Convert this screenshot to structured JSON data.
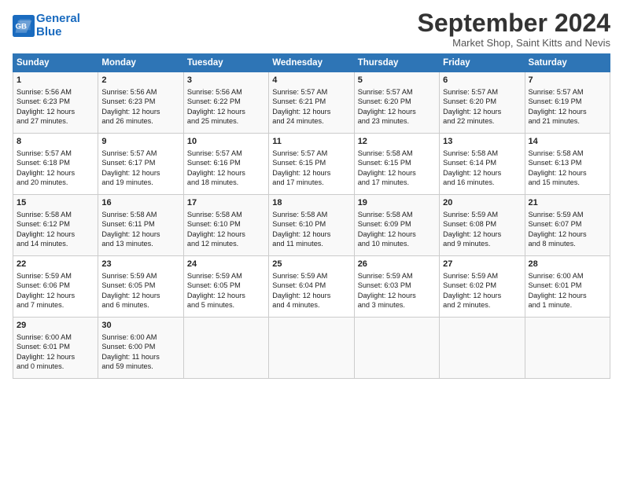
{
  "header": {
    "logo_line1": "General",
    "logo_line2": "Blue",
    "month_title": "September 2024",
    "subtitle": "Market Shop, Saint Kitts and Nevis"
  },
  "days_of_week": [
    "Sunday",
    "Monday",
    "Tuesday",
    "Wednesday",
    "Thursday",
    "Friday",
    "Saturday"
  ],
  "weeks": [
    [
      {
        "day": "1",
        "lines": [
          "Sunrise: 5:56 AM",
          "Sunset: 6:23 PM",
          "Daylight: 12 hours",
          "and 27 minutes."
        ]
      },
      {
        "day": "2",
        "lines": [
          "Sunrise: 5:56 AM",
          "Sunset: 6:23 PM",
          "Daylight: 12 hours",
          "and 26 minutes."
        ]
      },
      {
        "day": "3",
        "lines": [
          "Sunrise: 5:56 AM",
          "Sunset: 6:22 PM",
          "Daylight: 12 hours",
          "and 25 minutes."
        ]
      },
      {
        "day": "4",
        "lines": [
          "Sunrise: 5:57 AM",
          "Sunset: 6:21 PM",
          "Daylight: 12 hours",
          "and 24 minutes."
        ]
      },
      {
        "day": "5",
        "lines": [
          "Sunrise: 5:57 AM",
          "Sunset: 6:20 PM",
          "Daylight: 12 hours",
          "and 23 minutes."
        ]
      },
      {
        "day": "6",
        "lines": [
          "Sunrise: 5:57 AM",
          "Sunset: 6:20 PM",
          "Daylight: 12 hours",
          "and 22 minutes."
        ]
      },
      {
        "day": "7",
        "lines": [
          "Sunrise: 5:57 AM",
          "Sunset: 6:19 PM",
          "Daylight: 12 hours",
          "and 21 minutes."
        ]
      }
    ],
    [
      {
        "day": "8",
        "lines": [
          "Sunrise: 5:57 AM",
          "Sunset: 6:18 PM",
          "Daylight: 12 hours",
          "and 20 minutes."
        ]
      },
      {
        "day": "9",
        "lines": [
          "Sunrise: 5:57 AM",
          "Sunset: 6:17 PM",
          "Daylight: 12 hours",
          "and 19 minutes."
        ]
      },
      {
        "day": "10",
        "lines": [
          "Sunrise: 5:57 AM",
          "Sunset: 6:16 PM",
          "Daylight: 12 hours",
          "and 18 minutes."
        ]
      },
      {
        "day": "11",
        "lines": [
          "Sunrise: 5:57 AM",
          "Sunset: 6:15 PM",
          "Daylight: 12 hours",
          "and 17 minutes."
        ]
      },
      {
        "day": "12",
        "lines": [
          "Sunrise: 5:58 AM",
          "Sunset: 6:15 PM",
          "Daylight: 12 hours",
          "and 17 minutes."
        ]
      },
      {
        "day": "13",
        "lines": [
          "Sunrise: 5:58 AM",
          "Sunset: 6:14 PM",
          "Daylight: 12 hours",
          "and 16 minutes."
        ]
      },
      {
        "day": "14",
        "lines": [
          "Sunrise: 5:58 AM",
          "Sunset: 6:13 PM",
          "Daylight: 12 hours",
          "and 15 minutes."
        ]
      }
    ],
    [
      {
        "day": "15",
        "lines": [
          "Sunrise: 5:58 AM",
          "Sunset: 6:12 PM",
          "Daylight: 12 hours",
          "and 14 minutes."
        ]
      },
      {
        "day": "16",
        "lines": [
          "Sunrise: 5:58 AM",
          "Sunset: 6:11 PM",
          "Daylight: 12 hours",
          "and 13 minutes."
        ]
      },
      {
        "day": "17",
        "lines": [
          "Sunrise: 5:58 AM",
          "Sunset: 6:10 PM",
          "Daylight: 12 hours",
          "and 12 minutes."
        ]
      },
      {
        "day": "18",
        "lines": [
          "Sunrise: 5:58 AM",
          "Sunset: 6:10 PM",
          "Daylight: 12 hours",
          "and 11 minutes."
        ]
      },
      {
        "day": "19",
        "lines": [
          "Sunrise: 5:58 AM",
          "Sunset: 6:09 PM",
          "Daylight: 12 hours",
          "and 10 minutes."
        ]
      },
      {
        "day": "20",
        "lines": [
          "Sunrise: 5:59 AM",
          "Sunset: 6:08 PM",
          "Daylight: 12 hours",
          "and 9 minutes."
        ]
      },
      {
        "day": "21",
        "lines": [
          "Sunrise: 5:59 AM",
          "Sunset: 6:07 PM",
          "Daylight: 12 hours",
          "and 8 minutes."
        ]
      }
    ],
    [
      {
        "day": "22",
        "lines": [
          "Sunrise: 5:59 AM",
          "Sunset: 6:06 PM",
          "Daylight: 12 hours",
          "and 7 minutes."
        ]
      },
      {
        "day": "23",
        "lines": [
          "Sunrise: 5:59 AM",
          "Sunset: 6:05 PM",
          "Daylight: 12 hours",
          "and 6 minutes."
        ]
      },
      {
        "day": "24",
        "lines": [
          "Sunrise: 5:59 AM",
          "Sunset: 6:05 PM",
          "Daylight: 12 hours",
          "and 5 minutes."
        ]
      },
      {
        "day": "25",
        "lines": [
          "Sunrise: 5:59 AM",
          "Sunset: 6:04 PM",
          "Daylight: 12 hours",
          "and 4 minutes."
        ]
      },
      {
        "day": "26",
        "lines": [
          "Sunrise: 5:59 AM",
          "Sunset: 6:03 PM",
          "Daylight: 12 hours",
          "and 3 minutes."
        ]
      },
      {
        "day": "27",
        "lines": [
          "Sunrise: 5:59 AM",
          "Sunset: 6:02 PM",
          "Daylight: 12 hours",
          "and 2 minutes."
        ]
      },
      {
        "day": "28",
        "lines": [
          "Sunrise: 6:00 AM",
          "Sunset: 6:01 PM",
          "Daylight: 12 hours",
          "and 1 minute."
        ]
      }
    ],
    [
      {
        "day": "29",
        "lines": [
          "Sunrise: 6:00 AM",
          "Sunset: 6:01 PM",
          "Daylight: 12 hours",
          "and 0 minutes."
        ]
      },
      {
        "day": "30",
        "lines": [
          "Sunrise: 6:00 AM",
          "Sunset: 6:00 PM",
          "Daylight: 11 hours",
          "and 59 minutes."
        ]
      },
      {
        "day": "",
        "lines": []
      },
      {
        "day": "",
        "lines": []
      },
      {
        "day": "",
        "lines": []
      },
      {
        "day": "",
        "lines": []
      },
      {
        "day": "",
        "lines": []
      }
    ]
  ]
}
